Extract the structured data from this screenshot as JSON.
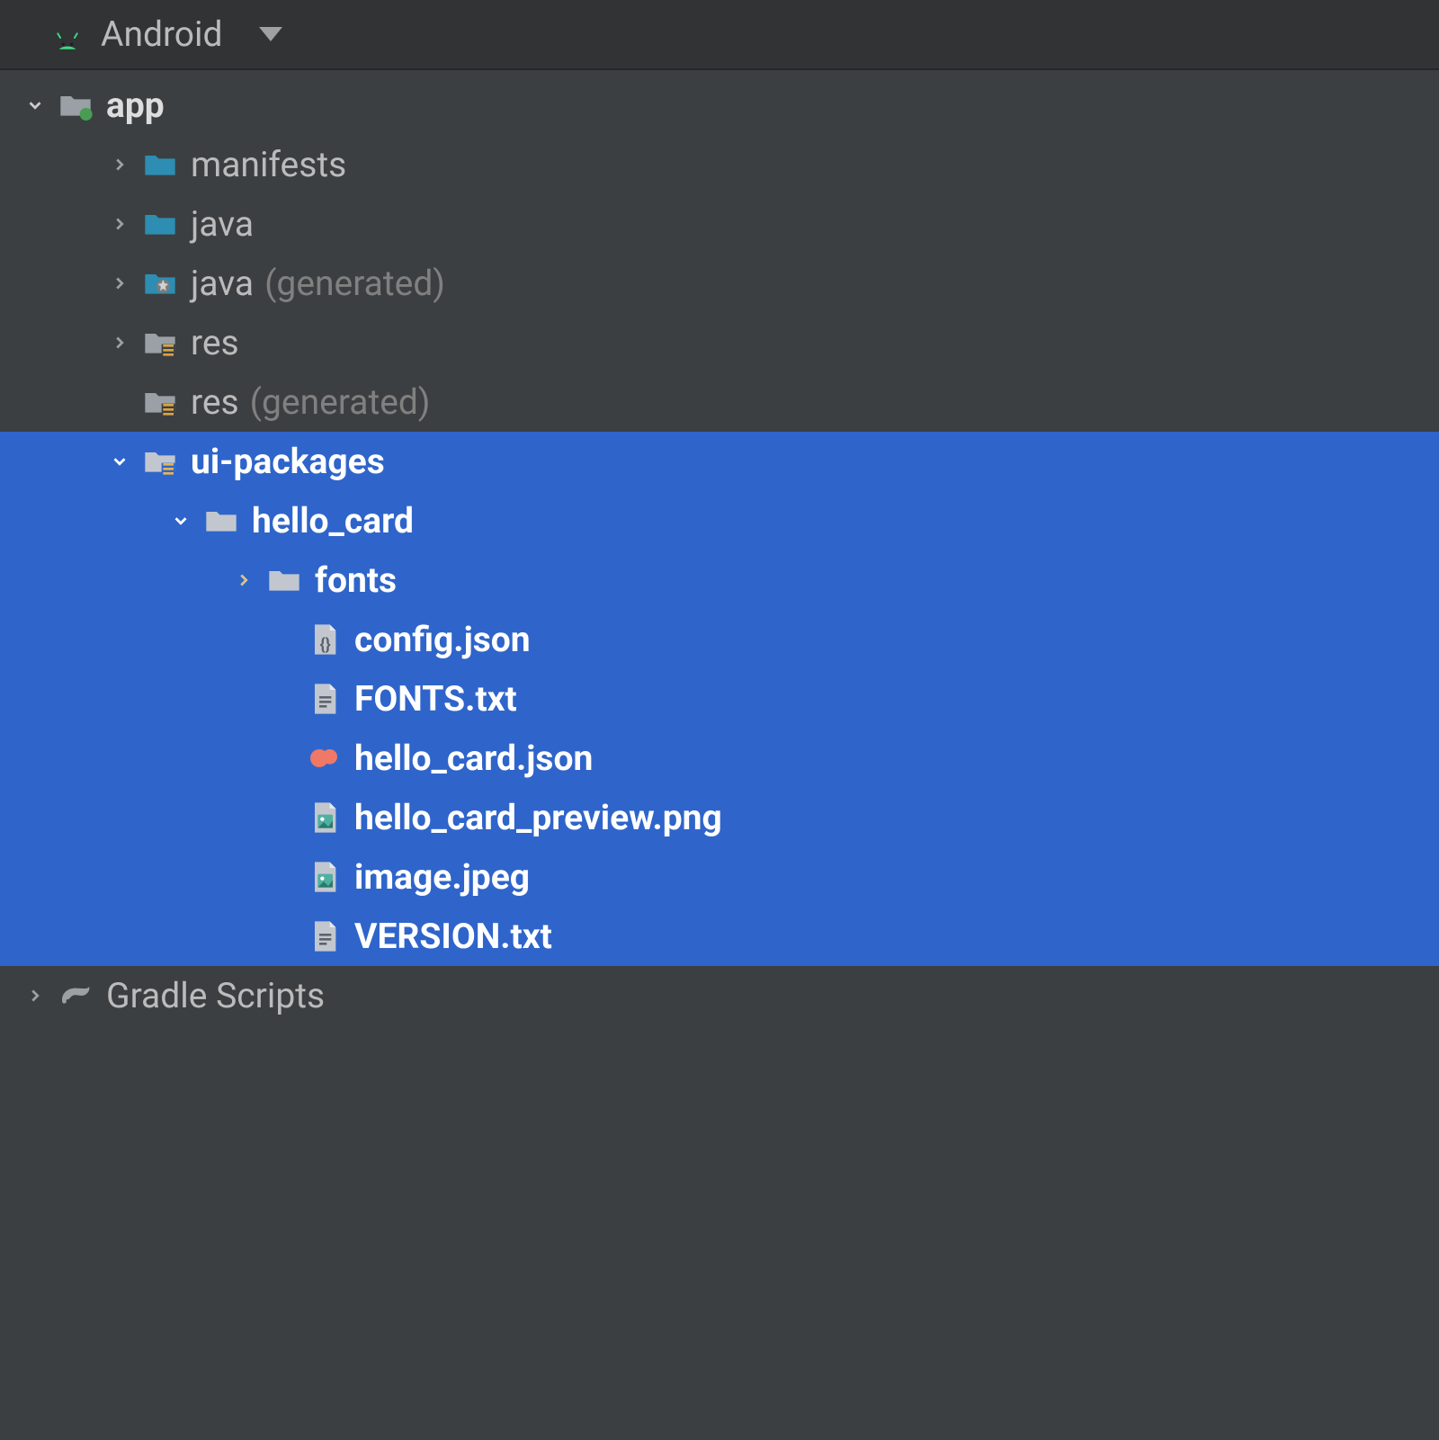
{
  "header": {
    "view_label": "Android"
  },
  "tree": {
    "app": {
      "label": "app",
      "children": {
        "manifests": {
          "label": "manifests"
        },
        "java": {
          "label": "java"
        },
        "java_gen": {
          "label": "java",
          "suffix": "(generated)"
        },
        "res": {
          "label": "res"
        },
        "res_gen": {
          "label": "res",
          "suffix": "(generated)"
        },
        "ui_packages": {
          "label": "ui-packages",
          "children": {
            "hello_card": {
              "label": "hello_card",
              "children": {
                "fonts": {
                  "label": "fonts"
                },
                "config": {
                  "label": "config.json"
                },
                "fonts_txt": {
                  "label": "FONTS.txt"
                },
                "hello_card_json": {
                  "label": "hello_card.json"
                },
                "preview": {
                  "label": "hello_card_preview.png"
                },
                "image": {
                  "label": "image.jpeg"
                },
                "version": {
                  "label": "VERSION.txt"
                }
              }
            }
          }
        }
      }
    },
    "gradle": {
      "label": "Gradle Scripts"
    }
  }
}
